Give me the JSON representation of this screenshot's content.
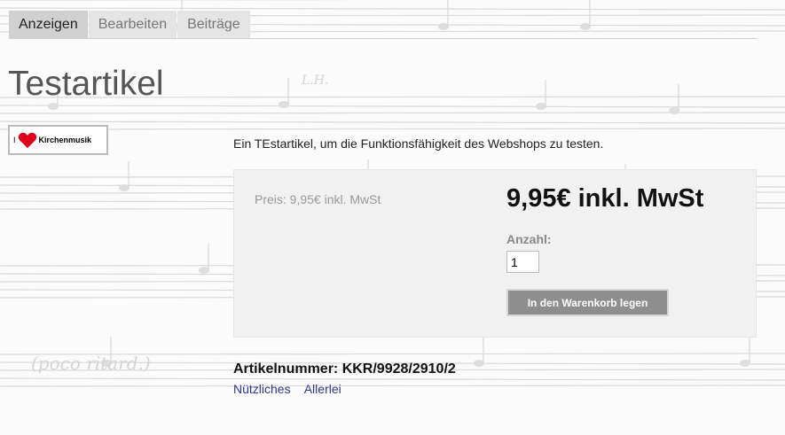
{
  "tabs": [
    {
      "label": "Anzeigen",
      "active": true
    },
    {
      "label": "Bearbeiten",
      "active": false
    },
    {
      "label": "Beiträge",
      "active": false
    }
  ],
  "page_title": "Testartikel",
  "logo": {
    "prefix": "I",
    "text": "Kirchenmusik",
    "heart_color": "#e0001b"
  },
  "description": "Ein TEstartikel, um die Funktionsfähigkeit des Webshops zu testen.",
  "price": {
    "small_label": "Preis: 9,95€ inkl. MwSt",
    "big_label": "9,95€ inkl. MwSt"
  },
  "quantity": {
    "label": "Anzahl:",
    "value": "1"
  },
  "cart_button_label": "In den Warenkorb legen",
  "article_number": "Artikelnummer: KKR/9928/2910/2",
  "tags": [
    "Nützliches",
    "Allerlei"
  ],
  "background": {
    "annotation_1": "(poco ritard.)",
    "annotation_2": "L.H."
  }
}
